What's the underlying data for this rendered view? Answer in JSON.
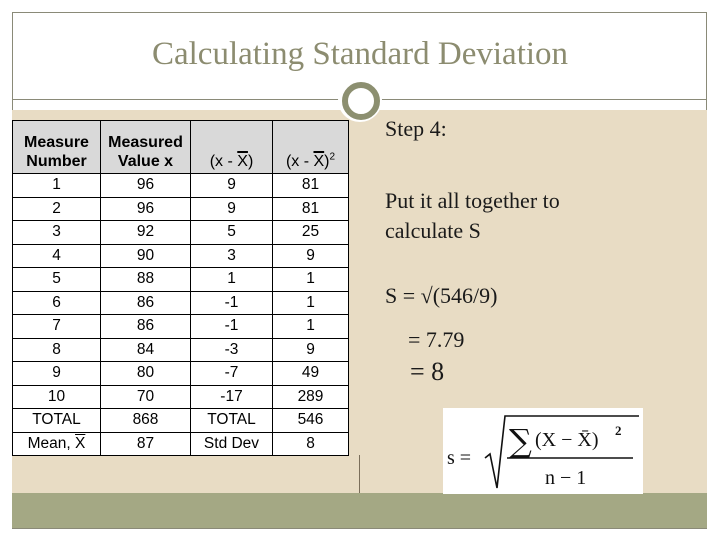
{
  "slide": {
    "title": "Calculating Standard Deviation"
  },
  "table": {
    "headers": [
      "Measure Number",
      "Measured Value x",
      "(x - X)",
      "(x - X)²"
    ],
    "header_lines": {
      "col1": [
        "Measure",
        "Number"
      ],
      "col2": [
        "Measured",
        "Value x"
      ],
      "col3_prefix": "(x - ",
      "col3_bar": "X",
      "col3_suffix": ")",
      "col4_prefix": "(x - ",
      "col4_bar": "X",
      "col4_suffix": ")",
      "col4_sup": "2"
    },
    "rows": [
      [
        "1",
        "96",
        "9",
        "81"
      ],
      [
        "2",
        "96",
        "9",
        "81"
      ],
      [
        "3",
        "92",
        "5",
        "25"
      ],
      [
        "4",
        "90",
        "3",
        "9"
      ],
      [
        "5",
        "88",
        "1",
        "1"
      ],
      [
        "6",
        "86",
        "-1",
        "1"
      ],
      [
        "7",
        "86",
        "-1",
        "1"
      ],
      [
        "8",
        "84",
        "-3",
        "9"
      ],
      [
        "9",
        "80",
        "-7",
        "49"
      ],
      [
        "10",
        "70",
        "-17",
        "289"
      ]
    ],
    "total_row": {
      "label": "TOTAL",
      "value": "868",
      "label2": "TOTAL",
      "value2": "546"
    },
    "mean_row": {
      "label_prefix": "Mean, ",
      "label_bar": "X",
      "value": "87",
      "label2": "Std Dev",
      "value2": "8"
    }
  },
  "explanation": {
    "step": "Step 4:",
    "description_line1": "Put it all together to",
    "description_line2": "calculate S",
    "formula_line1": "S = √(546/9)",
    "formula_line2": "= 7.79",
    "formula_line3": "= 8"
  },
  "formula_image": {
    "lhs": "s =",
    "numerator_sum": "∑",
    "numerator_expr": "(X − X̄)",
    "numerator_exp": "2",
    "denominator": "n − 1"
  },
  "colors": {
    "title": "#8c8c70",
    "content_bg": "#e8dcc4",
    "footer_bg": "#a4a884",
    "frame_border": "#8a8a78",
    "table_header_bg": "#d9d9d9"
  }
}
